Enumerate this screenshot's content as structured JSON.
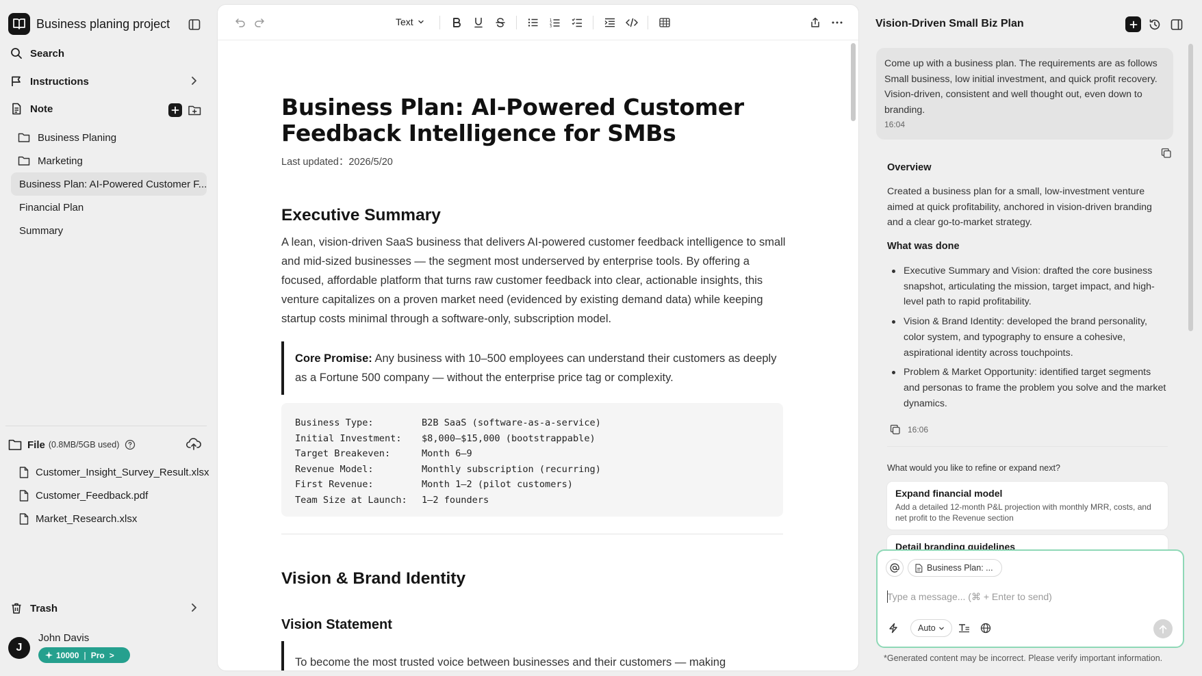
{
  "sidebar": {
    "project_title": "Business planing project",
    "search_label": "Search",
    "instructions_label": "Instructions",
    "note_label": "Note",
    "folders": [
      "Business Planing",
      "Marketing"
    ],
    "docs": [
      "Business Plan: AI-Powered Customer F...",
      "Financial Plan",
      "Summary"
    ],
    "file_label": "File",
    "file_usage": "(0.8MB/5GB used)",
    "files": [
      "Customer_Insight_Survey_Result.xlsx",
      "Customer_Feedback.pdf",
      "Market_Research.xlsx"
    ],
    "trash_label": "Trash",
    "user": {
      "initial": "J",
      "name": "John Davis",
      "credits": "10000",
      "plan": "Pro",
      "plan_arrow": ">"
    }
  },
  "editor": {
    "toolbar": {
      "text_style": "Text"
    },
    "title": "Business Plan: AI-Powered Customer Feedback Intelligence for SMBs",
    "last_updated": "Last updated：2026/5/20",
    "exec_summary_heading": "Executive Summary",
    "exec_summary_text": "A lean, vision-driven SaaS business that delivers AI-powered customer feedback intelligence to small and mid-sized businesses — the segment most underserved by enterprise tools. By offering a focused, affordable platform that turns raw customer feedback into clear, actionable insights, this venture capitalizes on a proven market need (evidenced by existing demand data) while keeping startup costs minimal through a software-only, subscription model.",
    "core_promise_label": "Core Promise:",
    "core_promise_text": " Any business with 10–500 employees can understand their customers as deeply as a Fortune 500 company — without the enterprise price tag or complexity.",
    "facts": [
      {
        "key": "Business Type:",
        "value": "B2B SaaS (software-as-a-service)"
      },
      {
        "key": "Initial Investment:",
        "value": "$8,000–$15,000 (bootstrappable)"
      },
      {
        "key": "Target Breakeven:",
        "value": "Month 6–9"
      },
      {
        "key": "Revenue Model:",
        "value": "Monthly subscription (recurring)"
      },
      {
        "key": "First Revenue:",
        "value": "Month 1–2 (pilot customers)"
      },
      {
        "key": "Team Size at Launch:",
        "value": "1–2 founders"
      }
    ],
    "vision_heading": "Vision & Brand Identity",
    "vision_statement_heading": "Vision Statement",
    "vision_statement_text": "To become the most trusted voice between businesses and their customers — making"
  },
  "chat": {
    "title": "Vision-Driven Small Biz Plan",
    "user_message": "Come up with a business plan. The requirements are as follows Small business, low initial investment, and quick profit recovery. Vision-driven, consistent and well thought out, even down to branding.",
    "user_time": "16:04",
    "overview_heading": "Overview",
    "overview_text": "Created a business plan for a small, low-investment venture aimed at quick profitability, anchored in vision-driven branding and a clear go-to-market strategy.",
    "done_heading": "What was done",
    "done_items": [
      "Executive Summary and Vision: drafted the core business snapshot, articulating the mission, target impact, and high-level path to rapid profitability.",
      "Vision & Brand Identity: developed the brand personality, color system, and typography to ensure a cohesive, aspirational identity across touchpoints.",
      "Problem & Market Opportunity: identified target segments and personas to frame the problem you solve and the market dynamics."
    ],
    "ai_time": "16:06",
    "refine_question": "What would you like to refine or expand next?",
    "suggestions": [
      {
        "title": "Expand financial model",
        "desc": "Add a detailed 12-month P&L projection with monthly MRR, costs, and net profit to the Revenue section"
      },
      {
        "title": "Detail branding guidelines",
        "desc": ""
      }
    ],
    "context_chip": "Business Plan: ...",
    "input_placeholder": "Type a message... (⌘ + Enter to send)",
    "mode": "Auto",
    "disclaimer": "*Generated content may be incorrect. Please verify important information."
  },
  "colors": {
    "accent": "#25a08e",
    "composer_border": "#8ed8b6",
    "dark": "#151515"
  }
}
